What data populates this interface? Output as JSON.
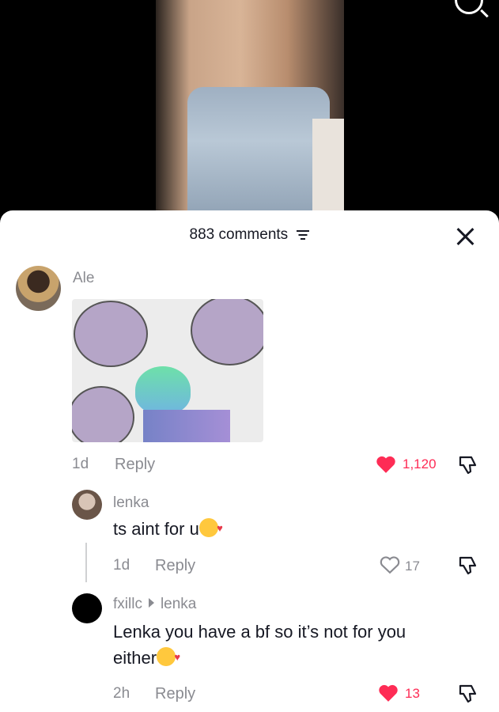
{
  "video": {
    "search_icon": "search-icon"
  },
  "sheet": {
    "title": "883 comments",
    "close_icon": "close-icon",
    "filter_icon": "filter-icon"
  },
  "comments": [
    {
      "username": "Ale",
      "age": "1d",
      "reply_label": "Reply",
      "likes": "1,120",
      "liked": true
    },
    {
      "username": "lenka",
      "text": "ts aint for u",
      "age": "1d",
      "reply_label": "Reply",
      "likes": "17",
      "liked": false
    },
    {
      "username": "fxillc",
      "reply_to": "lenka",
      "text_line1": "Lenka you have a bf so it’s not for you",
      "text_line2": "either",
      "age": "2h",
      "reply_label": "Reply",
      "likes": "13",
      "liked": true
    }
  ],
  "colors": {
    "like_red": "#fe2c55",
    "text": "#161823",
    "muted": "#8a8b91"
  }
}
